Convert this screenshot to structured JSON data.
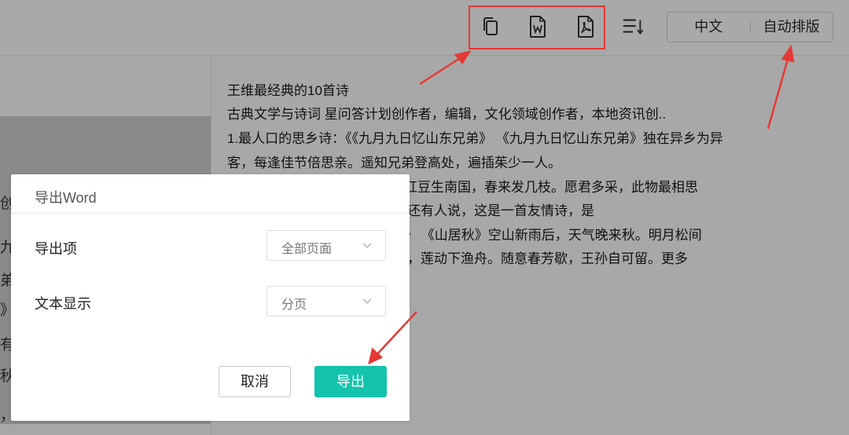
{
  "toolbar": {
    "icons": [
      "copy-icon",
      "word-doc-icon",
      "pdf-doc-icon",
      "sort-lines-icon"
    ],
    "lang_label": "中文",
    "auto_layout_label": "自动排版",
    "highlight_color": "#e53935"
  },
  "document": {
    "lines": [
      "王维最经典的10首诗",
      "    古典文学与诗词 星问答计划创作者，编辑，文化领域创作者，本地资讯创..",
      "1.最人口的思乡诗：《《九月九日忆山东兄弟》 《九月九日忆山东兄弟》独在异乡为异",
      "  客，每逢佳节倍思亲。遥知兄弟登高处，遍插茱少一人。",
      "思》红豆生南国，春来发几枝。愿君多采，此物最相思",
      "还有人说，这是一首友情诗，是",
      "居秋》 《山居秋》空山新雨后，天气晚来秋。明月松间",
      "，莲动下渔舟。随意春芳歇，王孙自可留。更多"
    ]
  },
  "left_fragments": [
    "创",
    "九",
    "弟",
    "》",
    "有",
    "秋",
    "，"
  ],
  "modal": {
    "title": "导出Word",
    "export_item_label": "导出项",
    "export_item_value": "全部页面",
    "text_display_label": "文本显示",
    "text_display_value": "分页",
    "cancel_label": "取消",
    "export_label": "导出",
    "accent_color": "#14c3ab"
  }
}
